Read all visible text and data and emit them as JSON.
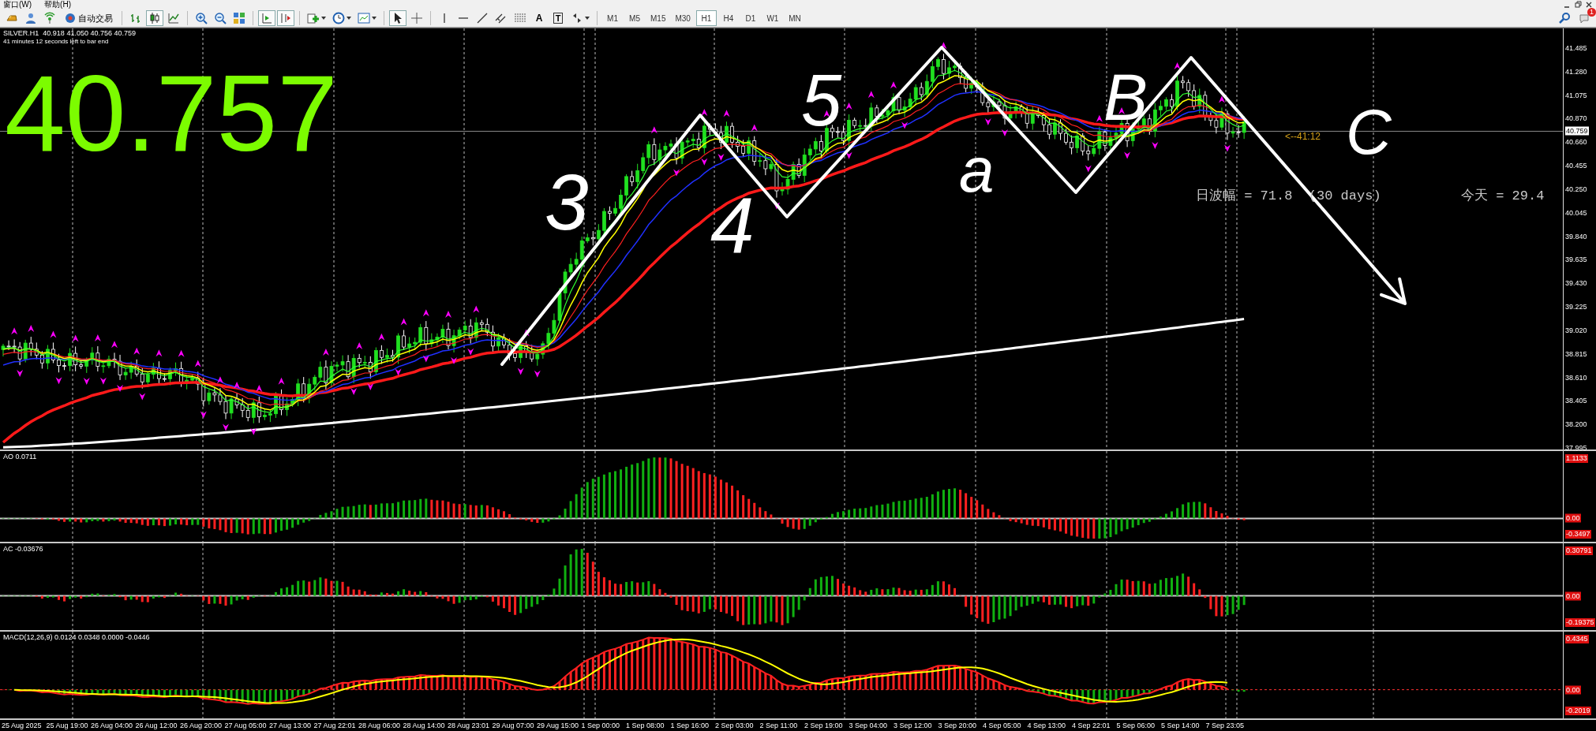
{
  "menu_bar": {
    "items": [
      "窗口(W)",
      "帮助(H)"
    ]
  },
  "toolbar": {
    "autotrade": "自动交易",
    "chart_types": [
      {
        "kind": "bars",
        "selected": false
      },
      {
        "kind": "candles",
        "selected": true
      },
      {
        "kind": "line",
        "selected": false
      }
    ],
    "scroll_toggles": [
      {
        "kind": "chart-shift",
        "on": true
      },
      {
        "kind": "auto-scroll",
        "on": true
      }
    ],
    "pointer_tools": [
      {
        "kind": "cursor",
        "selected": true
      },
      {
        "kind": "crosshair",
        "selected": false
      }
    ],
    "text_tool": "A",
    "label_tool": "T",
    "timeframes": [
      {
        "label": "M1",
        "selected": false
      },
      {
        "label": "M5",
        "selected": false
      },
      {
        "label": "M15",
        "selected": false
      },
      {
        "label": "M30",
        "selected": false
      },
      {
        "label": "H1",
        "selected": true
      },
      {
        "label": "H4",
        "selected": false
      },
      {
        "label": "D1",
        "selected": false
      },
      {
        "label": "W1",
        "selected": false
      },
      {
        "label": "MN",
        "selected": false
      }
    ],
    "notification_badge": "1"
  },
  "chart": {
    "symbol_line": "SILVER.H1  40.918 41.050 40.756 40.759",
    "timer": "41 minutes 12 seconds left to bar end",
    "big_price": "40.757",
    "countdown": "<--41:12",
    "daily_range": "日波幅 = 71.8  (30 days)",
    "today_range": "今天 = 29.4",
    "annotations": [
      "3",
      "4",
      "5",
      "a",
      "B",
      "C"
    ],
    "price_axis": [
      "41.485",
      "41.280",
      "41.075",
      "40.870",
      "40.660",
      "40.455",
      "40.250",
      "40.045",
      "39.840",
      "39.635",
      "39.430",
      "39.225",
      "39.020",
      "38.815",
      "38.610",
      "38.405",
      "38.200",
      "37.995"
    ],
    "current_price": "40.759"
  },
  "indicators": [
    {
      "kind": "ao",
      "label": "AO 0.0711",
      "scale": [
        "1.1133",
        "0.00",
        "-0.3497"
      ]
    },
    {
      "kind": "ac",
      "label": "AC -0.03676",
      "scale": [
        "0.30791",
        "0.00",
        "-0.19375"
      ]
    },
    {
      "kind": "macd",
      "label": "MACD(12,26,9) 0.0124 0.0348 0.0000 -0.0446",
      "scale": [
        "0.4345",
        "0.00",
        "-0.2019"
      ]
    }
  ],
  "time_axis": [
    "25 Aug 2025",
    "25 Aug 19:00",
    "26 Aug 04:00",
    "26 Aug 12:00",
    "26 Aug 20:00",
    "27 Aug 05:00",
    "27 Aug 13:00",
    "27 Aug 22:01",
    "28 Aug 06:00",
    "28 Aug 14:00",
    "28 Aug 23:01",
    "29 Aug 07:00",
    "29 Aug 15:00",
    "1 Sep 00:00",
    "1 Sep 08:00",
    "1 Sep 16:00",
    "2 Sep 03:00",
    "2 Sep 11:00",
    "2 Sep 19:00",
    "3 Sep 04:00",
    "3 Sep 12:00",
    "3 Sep 20:00",
    "4 Sep 05:00",
    "4 Sep 13:00",
    "4 Sep 22:01",
    "5 Sep 06:00",
    "5 Sep 14:00",
    "7 Sep 23:05"
  ]
}
